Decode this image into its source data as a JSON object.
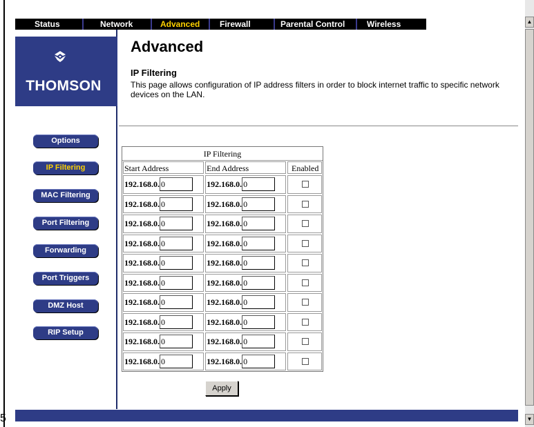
{
  "nav": {
    "tabs": [
      {
        "label": "Status"
      },
      {
        "label": "Network"
      },
      {
        "label": "Advanced"
      },
      {
        "label": "Firewall"
      },
      {
        "label": "Parental Control"
      },
      {
        "label": "Wireless"
      }
    ],
    "active_tab": "Advanced",
    "active_color": "#ffd200"
  },
  "logo": {
    "text": "THOMSON",
    "icon": "thomson-logo-icon"
  },
  "sidebar": {
    "items": [
      {
        "label": "Options"
      },
      {
        "label": "IP Filtering"
      },
      {
        "label": "MAC Filtering"
      },
      {
        "label": "Port Filtering"
      },
      {
        "label": "Forwarding"
      },
      {
        "label": "Port Triggers"
      },
      {
        "label": "DMZ Host"
      },
      {
        "label": "RIP Setup"
      }
    ],
    "active": "IP Filtering",
    "button_color": "#2e3c86"
  },
  "main": {
    "title": "Advanced",
    "section_title": "IP Filtering",
    "description": "This page allows configuration of IP address filters in order to block internet traffic to specific network devices on the LAN."
  },
  "table": {
    "title": "IP Filtering",
    "headers": {
      "start": "Start Address",
      "end": "End Address",
      "enabled": "Enabled"
    },
    "prefix": "192.168.0.",
    "rows": [
      {
        "start": "0",
        "end": "0",
        "enabled": false
      },
      {
        "start": "0",
        "end": "0",
        "enabled": false
      },
      {
        "start": "0",
        "end": "0",
        "enabled": false
      },
      {
        "start": "0",
        "end": "0",
        "enabled": false
      },
      {
        "start": "0",
        "end": "0",
        "enabled": false
      },
      {
        "start": "0",
        "end": "0",
        "enabled": false
      },
      {
        "start": "0",
        "end": "0",
        "enabled": false
      },
      {
        "start": "0",
        "end": "0",
        "enabled": false
      },
      {
        "start": "0",
        "end": "0",
        "enabled": false
      },
      {
        "start": "0",
        "end": "0",
        "enabled": false
      }
    ]
  },
  "apply_label": "Apply",
  "footer_left": "5"
}
